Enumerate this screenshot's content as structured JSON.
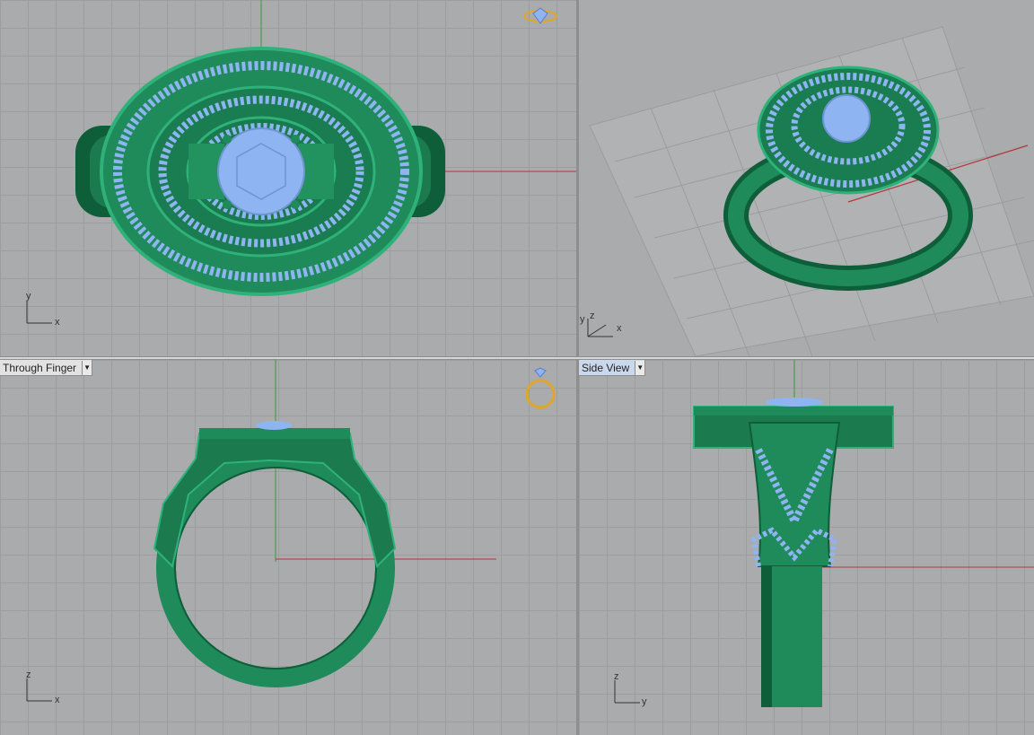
{
  "viewports": {
    "front": {
      "label": "Through Finger"
    },
    "right": {
      "label": "Side View"
    }
  },
  "axes": {
    "top": {
      "a": "y",
      "b": "x"
    },
    "persp": {
      "a": "z",
      "b": "y",
      "c": "x"
    },
    "front": {
      "a": "z",
      "b": "x"
    },
    "right": {
      "a": "z",
      "b": "y"
    }
  },
  "icons": {
    "top_preview": "diamond-preview-icon",
    "front_preview": "ring-preview-icon",
    "dropdown": "dropdown-arrow-icon"
  },
  "colors": {
    "metal": "#1f8a5a",
    "metal_dark": "#0f5e3a",
    "gem": "#8fb4f2",
    "grid_bg": "#a9abad",
    "x_axis": "#b03a3a",
    "y_axis": "#3a9a3a",
    "preview_icon": "#e0a628"
  }
}
